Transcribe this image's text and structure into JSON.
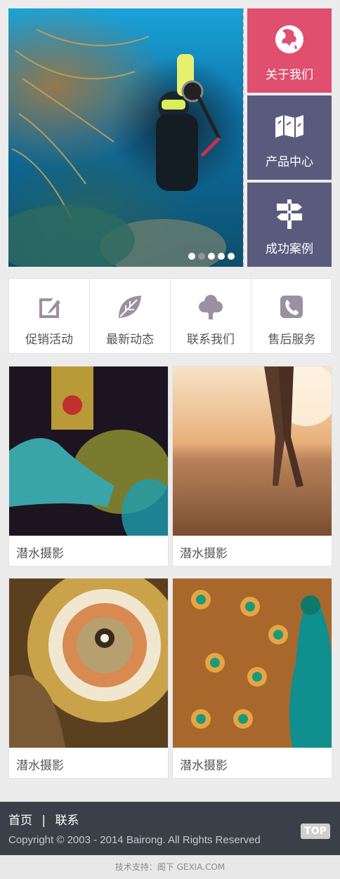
{
  "hero": {
    "dots": 5,
    "active_dot": 2
  },
  "tiles": [
    {
      "label": "关于我们",
      "icon": "globe-icon",
      "color": "#e04f70"
    },
    {
      "label": "产品中心",
      "icon": "map-icon",
      "color": "#5a5a7c"
    },
    {
      "label": "成功案例",
      "icon": "signpost-icon",
      "color": "#5a5a7c"
    }
  ],
  "nav": [
    {
      "label": "促销活动",
      "icon": "edit-icon"
    },
    {
      "label": "最新动态",
      "icon": "leaf-icon"
    },
    {
      "label": "联系我们",
      "icon": "tree-icon"
    },
    {
      "label": "售后服务",
      "icon": "phone-icon"
    }
  ],
  "cards": [
    {
      "label": "潜水摄影"
    },
    {
      "label": "潜水摄影"
    },
    {
      "label": "潜水摄影"
    },
    {
      "label": "潜水摄影"
    }
  ],
  "footer": {
    "link_home": "首页",
    "separator": "|",
    "link_contact": "联系",
    "copyright": "Copyright © 2003 - 2014 Bairong. All Rights Reserved",
    "top": "TOP"
  },
  "tech_support": "技术支持：阁下 GEXIA.COM"
}
